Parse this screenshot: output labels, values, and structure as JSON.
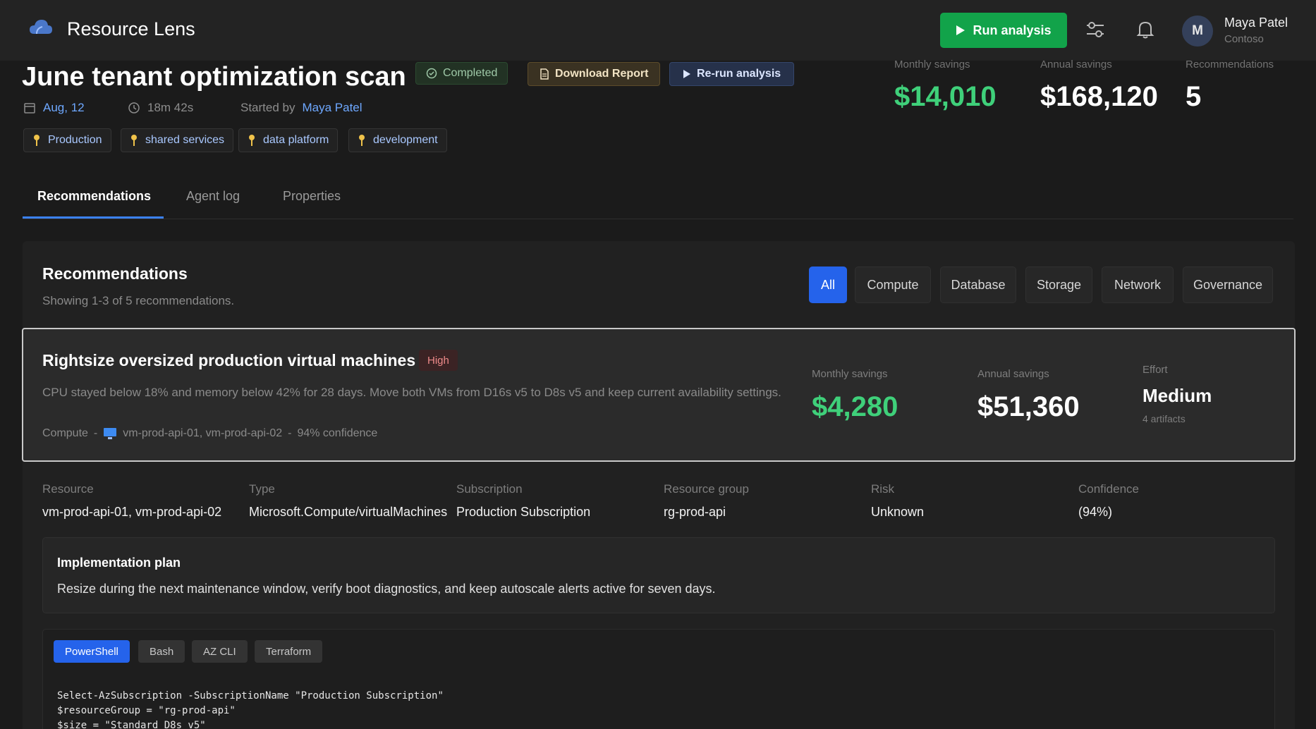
{
  "app": {
    "title": "Resource Lens",
    "run_button": "Run analysis",
    "user": {
      "initial": "M",
      "name": "Maya Patel",
      "org": "Contoso"
    }
  },
  "scan": {
    "title": "June tenant optimization scan",
    "status": "Completed",
    "download_label": "Download Report",
    "rerun_label": "Re-run analysis",
    "date": "Aug, 12",
    "duration": "18m 42s",
    "started_by_prefix": "Started by",
    "started_by": "Maya Patel",
    "tags": [
      "Production",
      "shared services",
      "data platform",
      "development"
    ],
    "kpis": [
      {
        "label": "Monthly savings",
        "value": "$14,010"
      },
      {
        "label": "Annual savings",
        "value": "$168,120"
      },
      {
        "label": "Recommendations",
        "value": "5"
      }
    ]
  },
  "tabs": [
    "Recommendations",
    "Agent log",
    "Properties"
  ],
  "recommendations": {
    "heading": "Recommendations",
    "subtitle": "Showing 1-3 of 5 recommendations.",
    "filters": [
      "All",
      "Compute",
      "Database",
      "Storage",
      "Network",
      "Governance"
    ],
    "active_filter": "All"
  },
  "card": {
    "title": "Rightsize oversized production virtual machines",
    "priority": "High",
    "description": "CPU stayed below 18% and memory below 42% for 28 days. Move both VMs from D16s v5 to D8s v5 and keep current availability settings.",
    "category": "Compute",
    "resources": "vm-prod-api-01, vm-prod-api-02",
    "confidence_text": "94% confidence",
    "monthly_label": "Monthly savings",
    "monthly_value": "$4,280",
    "annual_label": "Annual savings",
    "annual_value": "$51,360",
    "effort_label": "Effort",
    "effort_value": "Medium",
    "artifacts": "4 artifacts"
  },
  "details": [
    {
      "label": "Resource",
      "value": "vm-prod-api-01, vm-prod-api-02"
    },
    {
      "label": "Type",
      "value": "Microsoft.Compute/virtualMachines"
    },
    {
      "label": "Subscription",
      "value": "Production Subscription"
    },
    {
      "label": "Resource group",
      "value": "rg-prod-api"
    },
    {
      "label": "Risk",
      "value": "Unknown"
    },
    {
      "label": "Confidence",
      "value": "(94%)"
    }
  ],
  "implementation": {
    "title": "Implementation plan",
    "text": "Resize during the next maintenance window, verify boot diagnostics, and keep autoscale alerts active for seven days."
  },
  "code": {
    "tabs": [
      "PowerShell",
      "Bash",
      "AZ CLI",
      "Terraform"
    ],
    "active_tab": "PowerShell",
    "lines": [
      "Select-AzSubscription -SubscriptionName \"Production Subscription\"",
      "$resourceGroup = \"rg-prod-api\"",
      "$size = \"Standard_D8s_v5\""
    ]
  },
  "colors": {
    "accent_green": "#12a34a",
    "savings_green": "#3fd07a",
    "accent_blue": "#2563eb",
    "high_red": "#ee8a8a"
  }
}
